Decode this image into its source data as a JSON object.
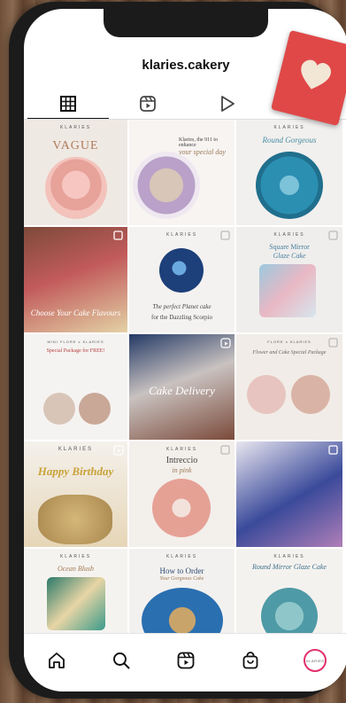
{
  "profile": {
    "username": "klaries.cakery",
    "avatar_text": "KLARIES"
  },
  "tabs": [
    {
      "name": "grid-tab",
      "icon": "grid-icon",
      "active": true
    },
    {
      "name": "reels-tab",
      "icon": "reels-icon",
      "active": false
    },
    {
      "name": "tagged-tab",
      "icon": "play-icon",
      "active": false
    }
  ],
  "posts": [
    {
      "brand": "KLARIES",
      "title": "VAGUE",
      "subtitle": "",
      "badge": ""
    },
    {
      "brand": "",
      "title": "Klaries, the 911 to enhance",
      "subtitle": "your special day",
      "badge": ""
    },
    {
      "brand": "KLARIES",
      "title": "",
      "subtitle": "Round Gorgeous",
      "badge": ""
    },
    {
      "brand": "",
      "title": "Choose Your Cake Flavours",
      "subtitle": "",
      "badge": "multi"
    },
    {
      "brand": "KLARIES",
      "title": "The perfect Planet cake",
      "subtitle": "for the Dazzling Scorpio",
      "badge": "multi"
    },
    {
      "brand": "KLARIES",
      "title": "Square Mirror",
      "subtitle": "Glaze Cake",
      "badge": "multi"
    },
    {
      "brand": "MINI FLORE x KLARIES",
      "title": "Special Package for FREE!",
      "subtitle": "",
      "badge": ""
    },
    {
      "brand": "",
      "title": "Cake Delivery",
      "subtitle": "",
      "badge": "reel"
    },
    {
      "brand": "FLORE x KLARIES",
      "title": "",
      "subtitle": "Flower and Cake Special Package",
      "badge": "multi"
    },
    {
      "brand": "KLARIES",
      "title": "Happy Birthday",
      "subtitle": "",
      "badge": "reel"
    },
    {
      "brand": "KLARIES",
      "title": "Intreccio",
      "subtitle": "in pink",
      "badge": "multi"
    },
    {
      "brand": "",
      "title": "",
      "subtitle": "",
      "badge": "multi"
    },
    {
      "brand": "KLARIES",
      "title": "",
      "subtitle": "Ocean Blush",
      "badge": ""
    },
    {
      "brand": "KLARIES",
      "title": "How to Order",
      "subtitle": "Your Gorgeous Cake",
      "badge": ""
    },
    {
      "brand": "KLARIES",
      "title": "",
      "subtitle": "Round Mirror Glaze Cake",
      "badge": ""
    }
  ],
  "nav": [
    {
      "name": "home",
      "icon": "home-icon"
    },
    {
      "name": "search",
      "icon": "search-icon"
    },
    {
      "name": "reels",
      "icon": "reels-icon"
    },
    {
      "name": "shop",
      "icon": "shop-icon"
    },
    {
      "name": "profile",
      "icon": "avatar"
    }
  ],
  "colors": {
    "accent": "#e1306c",
    "sticker": "#e04848"
  }
}
